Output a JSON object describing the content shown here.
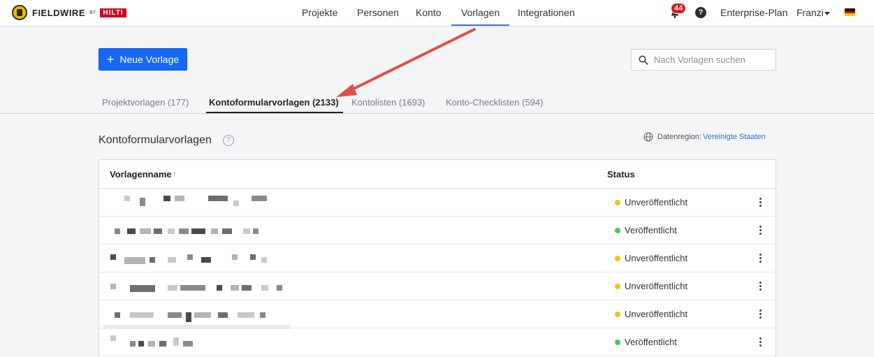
{
  "brand": {
    "name": "FIELDWIRE",
    "by": "BY",
    "partner": "HILTI"
  },
  "nav": {
    "items": [
      {
        "label": "Projekte",
        "active": false
      },
      {
        "label": "Personen",
        "active": false
      },
      {
        "label": "Konto",
        "active": false
      },
      {
        "label": "Vorlagen",
        "active": true
      },
      {
        "label": "Integrationen",
        "active": false
      }
    ],
    "notifications": "44",
    "help": "?",
    "plan": "Enterprise-Plan",
    "user": "Franzi"
  },
  "toolbar": {
    "new_template_label": "Neue Vorlage",
    "search_placeholder": "Nach Vorlagen suchen"
  },
  "tabs": [
    {
      "label": "Projektvorlagen (177)",
      "active": false
    },
    {
      "label": "Kontoformularvorlagen (2133)",
      "active": true
    },
    {
      "label": "Kontolisten (1693)",
      "active": false
    },
    {
      "label": "Konto-Checklisten (594)",
      "active": false
    }
  ],
  "section": {
    "title": "Kontoformularvorlagen",
    "region_label": "Datenregion:",
    "region_value": "Vereinigte Staaten"
  },
  "table": {
    "columns": {
      "name": "Vorlagenname",
      "status": "Status"
    },
    "rows": [
      {
        "status": "Unveröffentlicht",
        "status_color": "#f5c218"
      },
      {
        "status": "Veröffentlicht",
        "status_color": "#3ecf5c"
      },
      {
        "status": "Unveröffentlicht",
        "status_color": "#f5c218"
      },
      {
        "status": "Unveröffentlicht",
        "status_color": "#f5c218"
      },
      {
        "status": "Unveröffentlicht",
        "status_color": "#f5c218"
      },
      {
        "status": "Veröffentlicht",
        "status_color": "#3ecf5c"
      }
    ]
  },
  "colors": {
    "primary": "#1668f5",
    "active_nav_underline": "#3a7bd5",
    "link": "#2f6fd6",
    "annotation_arrow": "#e0504a",
    "badge": "#e0131b"
  },
  "icons": {
    "logo": "fieldwire-logo-icon",
    "notifications": "bell-icon",
    "help": "help-icon",
    "search": "search-icon",
    "region": "globe-icon",
    "sort": "sort-arrow-up-icon",
    "row_menu": "kebab-menu-icon",
    "flag": "german-flag-icon"
  }
}
